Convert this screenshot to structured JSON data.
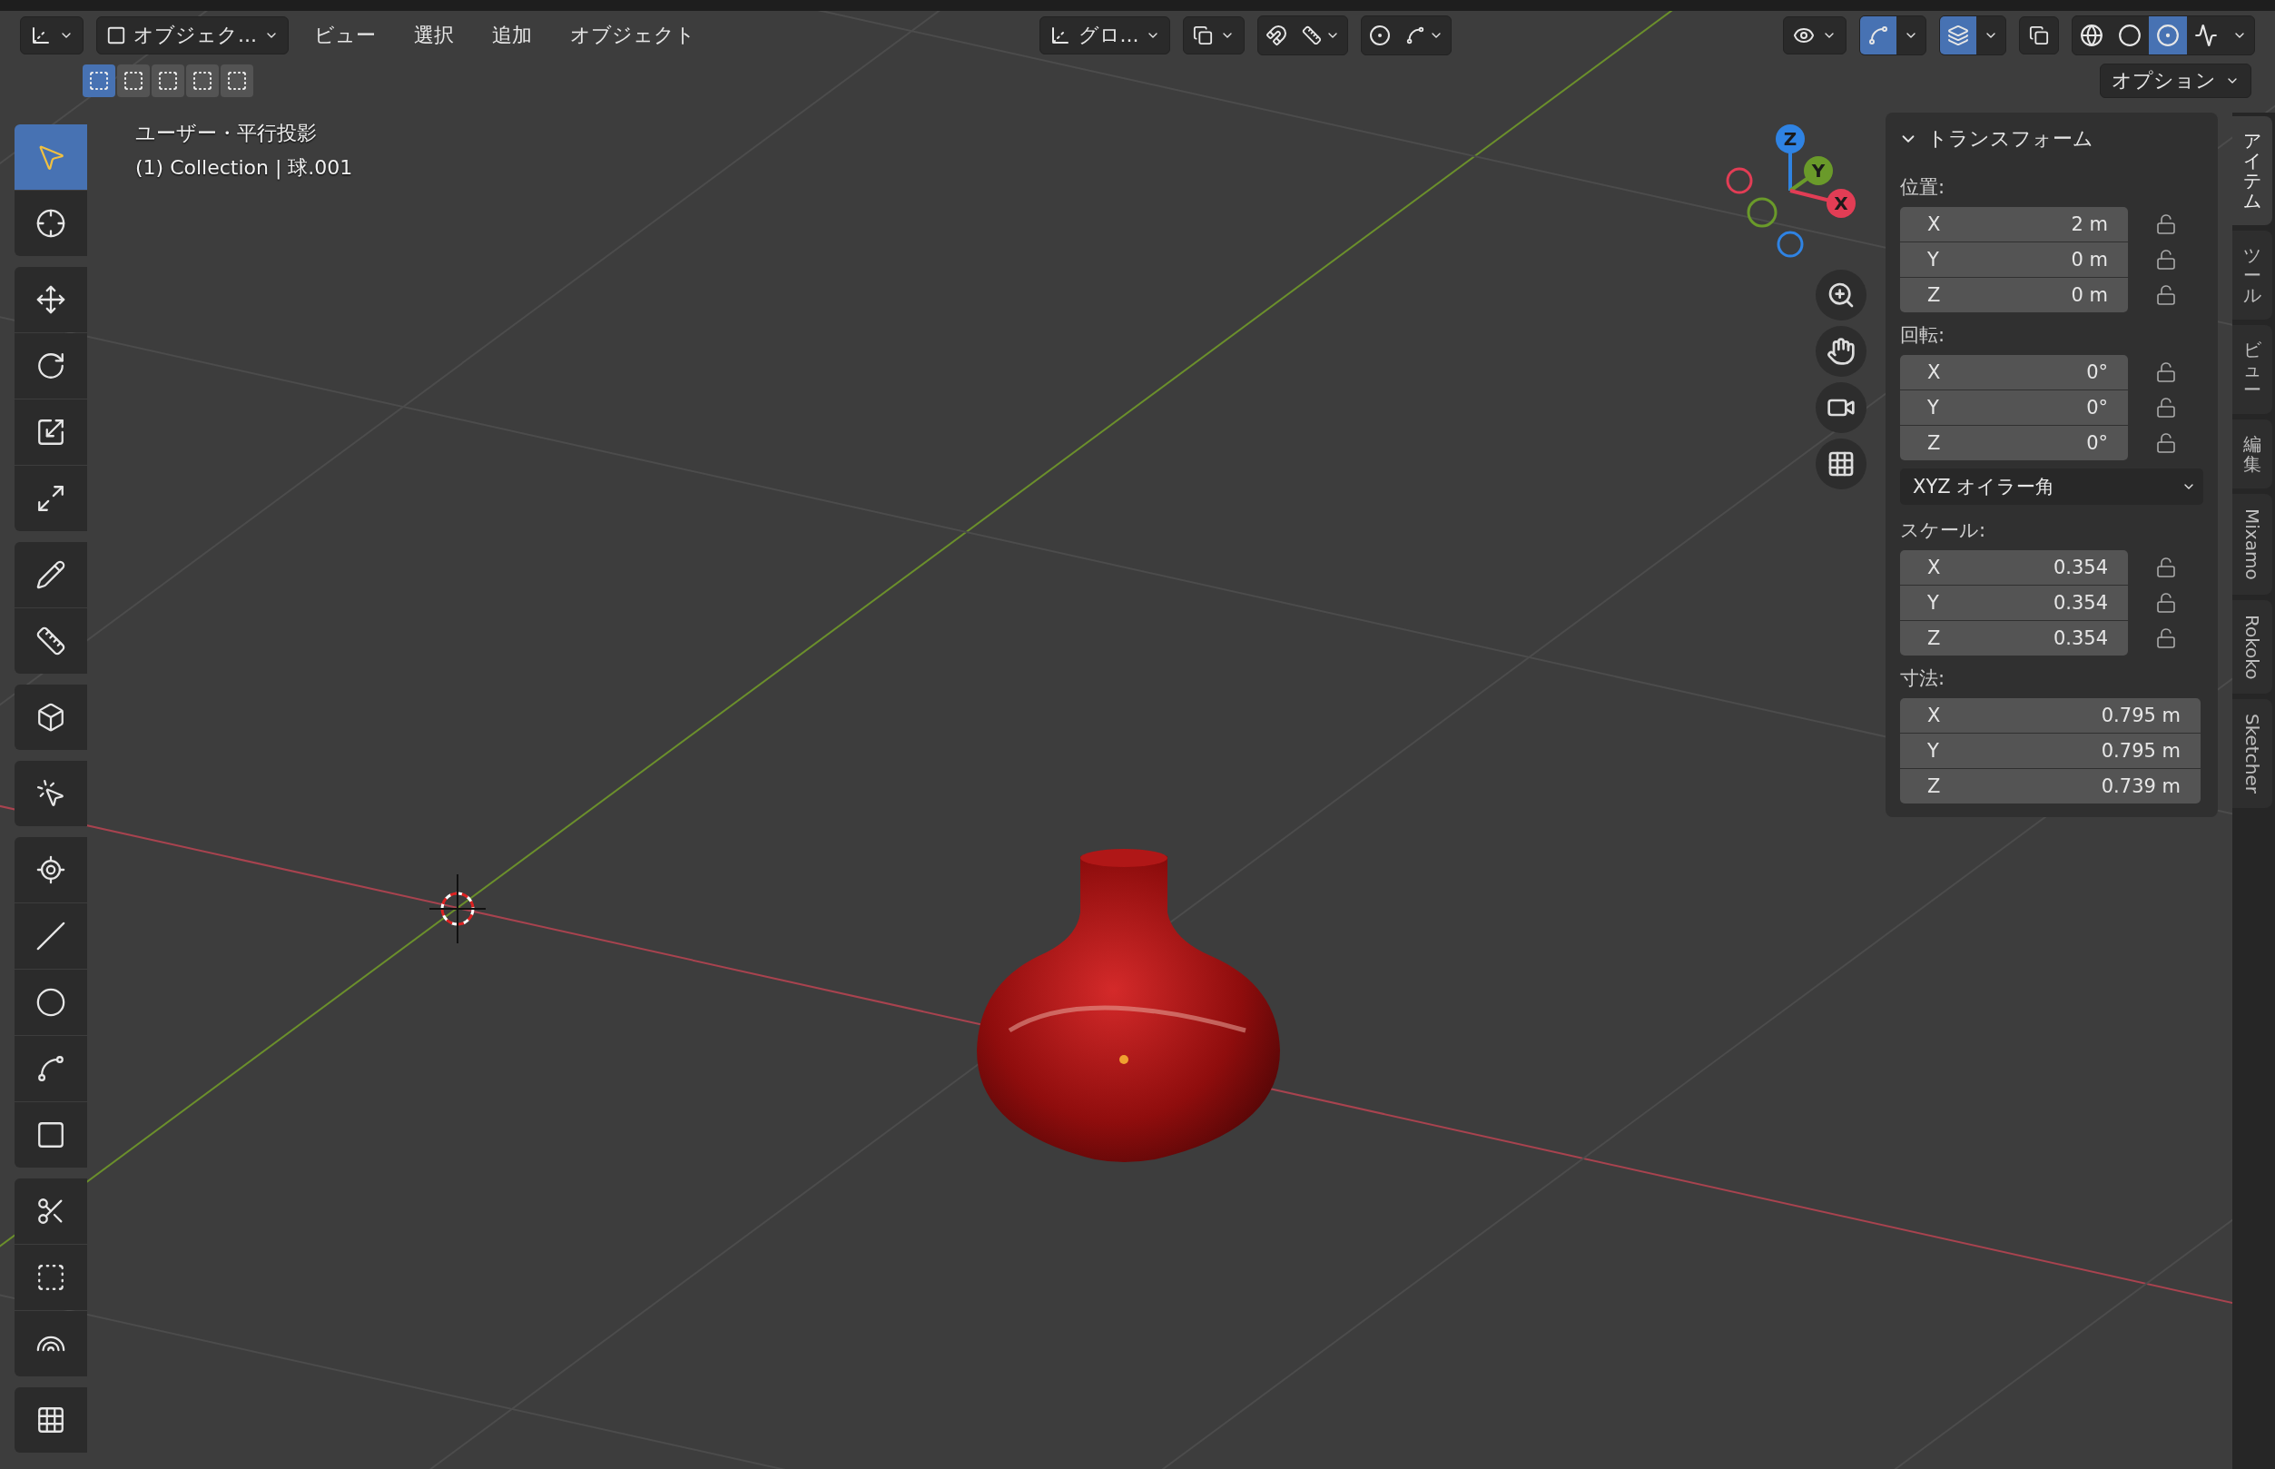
{
  "header": {
    "mode": "オブジェク...",
    "menus": [
      "ビュー",
      "選択",
      "追加",
      "オブジェクト"
    ],
    "orientation": "グロ...",
    "snap": {
      "on": false
    },
    "proportional_editing": {
      "on": false
    },
    "gizmos": {
      "on": true
    },
    "overlays": {
      "on": true
    },
    "xray": {
      "on": false
    },
    "shading_modes": [
      {
        "selected": false
      },
      {
        "selected": false
      },
      {
        "selected": true
      },
      {
        "selected": false
      }
    ]
  },
  "selection_modes": [
    {
      "selected": true
    },
    {
      "selected": false
    },
    {
      "selected": false
    },
    {
      "selected": false
    },
    {
      "selected": false
    }
  ],
  "options_label": "オプション",
  "viewport": {
    "view_name": "ユーザー・平行投影",
    "object_info": "(1) Collection | 球.001"
  },
  "navigation_gizmo": {
    "axes": [
      {
        "label": "Z",
        "color": "#2f83e3"
      },
      {
        "label": "Y",
        "color": "#6a9a2a"
      },
      {
        "label": "X",
        "color": "#e23d55"
      }
    ]
  },
  "toolbar": {
    "groups": [
      {
        "tools": [
          {
            "selected": true
          },
          {
            "selected": false
          }
        ]
      },
      {
        "tools": [
          {
            "selected": false
          },
          {
            "selected": false
          },
          {
            "selected": false
          },
          {
            "selected": false
          }
        ]
      },
      {
        "tools": [
          {
            "selected": false
          },
          {
            "selected": false
          }
        ]
      },
      {
        "tools": [
          {
            "selected": false
          }
        ]
      },
      {
        "tools": [
          {
            "selected": false
          }
        ]
      },
      {
        "tools": [
          {
            "selected": false
          },
          {
            "selected": false
          },
          {
            "selected": false
          },
          {
            "selected": false
          },
          {
            "selected": false
          }
        ]
      },
      {
        "tools": [
          {
            "selected": false
          },
          {
            "selected": false
          },
          {
            "selected": false
          }
        ]
      },
      {
        "tools": [
          {
            "selected": false
          }
        ]
      }
    ]
  },
  "sidebar_panel": {
    "title": "トランスフォーム",
    "expanded": true,
    "sections": [
      {
        "kind": "vector",
        "label": "位置:",
        "fields": [
          {
            "axis": "X",
            "value": "2 m",
            "locked": false
          },
          {
            "axis": "Y",
            "value": "0 m",
            "locked": false
          },
          {
            "axis": "Z",
            "value": "0 m",
            "locked": false
          }
        ]
      },
      {
        "kind": "vector",
        "label": "回転:",
        "fields": [
          {
            "axis": "X",
            "value": "0°",
            "locked": false
          },
          {
            "axis": "Y",
            "value": "0°",
            "locked": false
          },
          {
            "axis": "Z",
            "value": "0°",
            "locked": false
          }
        ]
      },
      {
        "kind": "dropdown",
        "value": "XYZ オイラー角"
      },
      {
        "kind": "vector",
        "label": "スケール:",
        "fields": [
          {
            "axis": "X",
            "value": "0.354",
            "locked": false
          },
          {
            "axis": "Y",
            "value": "0.354",
            "locked": false
          },
          {
            "axis": "Z",
            "value": "0.354",
            "locked": false
          }
        ]
      },
      {
        "kind": "plain",
        "label": "寸法:",
        "fields": [
          {
            "axis": "X",
            "value": "0.795 m"
          },
          {
            "axis": "Y",
            "value": "0.795 m"
          },
          {
            "axis": "Z",
            "value": "0.739 m"
          }
        ]
      }
    ]
  },
  "sidebar_tabs": [
    {
      "label": "アイテム",
      "kind": "cjk",
      "selected": true
    },
    {
      "label": "ツール",
      "kind": "cjk",
      "selected": false
    },
    {
      "label": "ビュー",
      "kind": "cjk",
      "selected": false
    },
    {
      "label": "編集",
      "kind": "cjk",
      "selected": false
    },
    {
      "label": "Mixamo",
      "kind": "latin",
      "selected": false
    },
    {
      "label": "Rokoko",
      "kind": "latin",
      "selected": false
    },
    {
      "label": "Sketcher",
      "kind": "latin",
      "selected": false
    }
  ]
}
